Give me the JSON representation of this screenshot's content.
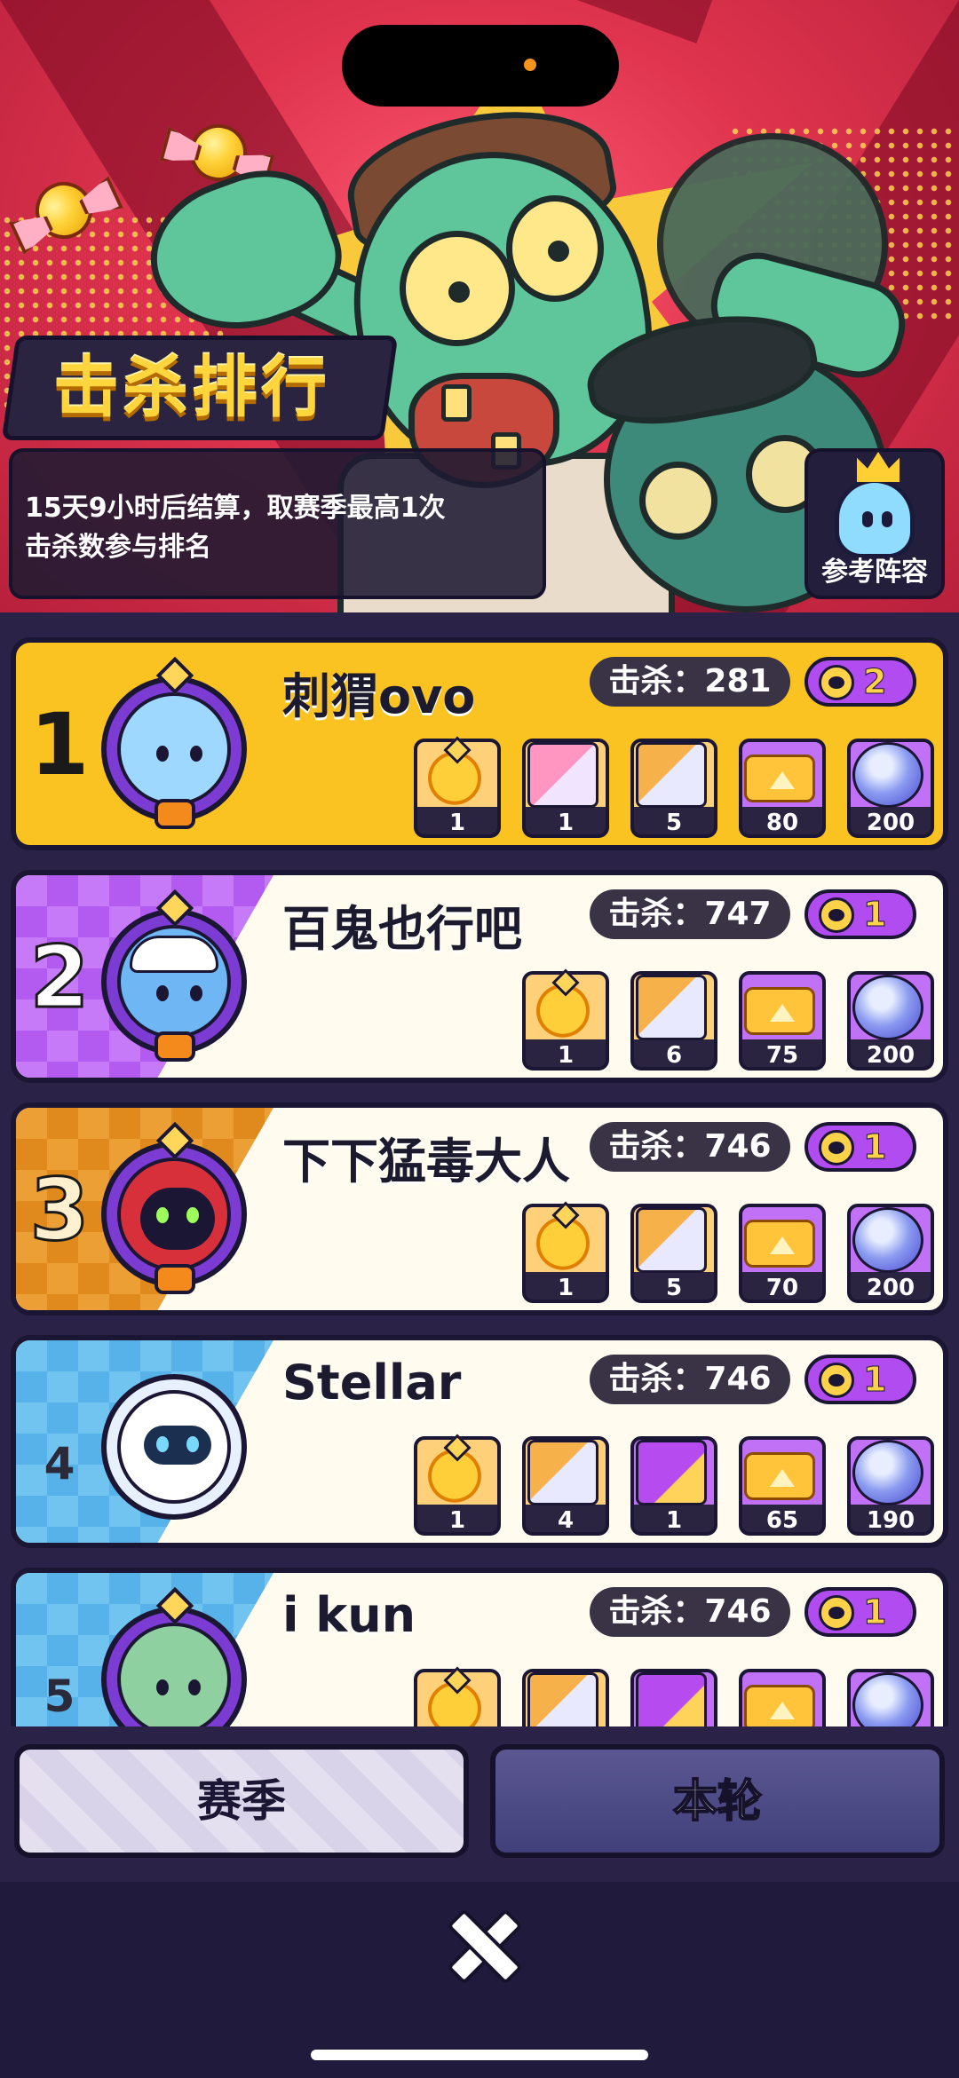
{
  "header": {
    "title": "击杀排行",
    "info": "15天9小时后结算，取赛季最高1次\n击杀数参与排名",
    "ref_button": "参考阵容"
  },
  "rows": [
    {
      "rank": "1",
      "name": "刺猬ovo",
      "kills": "击杀：281",
      "tokens": "2",
      "rewards": [
        "1",
        "1",
        "5",
        "80",
        "200"
      ]
    },
    {
      "rank": "2",
      "name": "百鬼也行吧",
      "kills": "击杀：747",
      "tokens": "1",
      "rewards": [
        "1",
        "6",
        "75",
        "200"
      ]
    },
    {
      "rank": "3",
      "name": "下下猛毒大人",
      "kills": "击杀：746",
      "tokens": "1",
      "rewards": [
        "1",
        "5",
        "70",
        "200"
      ]
    },
    {
      "rank": "4",
      "name": "Stellar",
      "kills": "击杀：746",
      "tokens": "1",
      "rewards": [
        "1",
        "4",
        "1",
        "65",
        "190"
      ]
    },
    {
      "rank": "5",
      "name": "i kun",
      "kills": "击杀：746",
      "tokens": "1",
      "rewards": [
        "",
        "",
        "",
        "",
        ""
      ]
    }
  ],
  "tabs": {
    "season": "赛季",
    "round": "本轮"
  },
  "colors": {
    "gold_row": "#fbc321",
    "accent_purple": "#b14cf0",
    "hero_red": "#e0344e"
  },
  "icons": {
    "close": "close-icon",
    "ref": "ghost-crown-icon",
    "token": "skull-token-icon"
  }
}
